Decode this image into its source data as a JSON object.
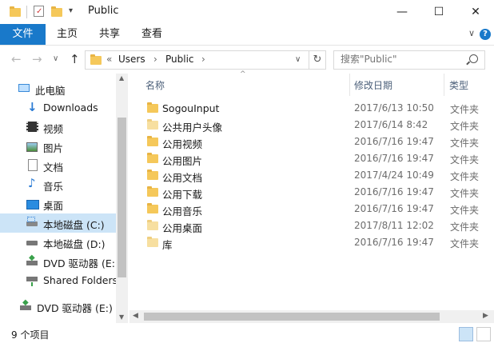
{
  "window": {
    "title": "Public",
    "minimize": "—",
    "maximize": "☐",
    "close": "✕"
  },
  "ribbon": {
    "file_tab": "文件",
    "tabs": [
      "主页",
      "共享",
      "查看"
    ],
    "help": "?",
    "collapse": "∨"
  },
  "nav": {
    "back": "←",
    "forward": "→",
    "recent": "∨",
    "up": "↑",
    "breadcrumb_overflow": "«",
    "crumbs": [
      "Users",
      "Public"
    ],
    "sep": "›",
    "dropdown": "∨",
    "refresh": "↻",
    "search_placeholder": "搜索\"Public\""
  },
  "sidebar": {
    "items": [
      {
        "label": "此电脑",
        "icon": "computer-icon"
      },
      {
        "label": "Downloads",
        "icon": "download-icon"
      },
      {
        "label": "视频",
        "icon": "video-icon"
      },
      {
        "label": "图片",
        "icon": "picture-icon"
      },
      {
        "label": "文档",
        "icon": "document-icon"
      },
      {
        "label": "音乐",
        "icon": "music-icon"
      },
      {
        "label": "桌面",
        "icon": "desktop-icon"
      },
      {
        "label": "本地磁盘 (C:)",
        "icon": "drive-icon",
        "selected": true
      },
      {
        "label": "本地磁盘 (D:)",
        "icon": "drive-icon"
      },
      {
        "label": "DVD 驱动器 (E:)",
        "icon": "dvd-icon"
      },
      {
        "label": "Shared Folders",
        "icon": "network-drive-icon"
      },
      {
        "label": "DVD 驱动器 (E:) C",
        "icon": "dvd-icon"
      }
    ]
  },
  "columns": {
    "name": "名称",
    "date": "修改日期",
    "type": "类型"
  },
  "files": [
    {
      "name": "SogouInput",
      "date": "2017/6/13 10:50",
      "type": "文件夹",
      "pale": false
    },
    {
      "name": "公共用户头像",
      "date": "2017/6/14 8:42",
      "type": "文件夹",
      "pale": true
    },
    {
      "name": "公用视频",
      "date": "2016/7/16 19:47",
      "type": "文件夹",
      "pale": false
    },
    {
      "name": "公用图片",
      "date": "2016/7/16 19:47",
      "type": "文件夹",
      "pale": false
    },
    {
      "name": "公用文档",
      "date": "2017/4/24 10:49",
      "type": "文件夹",
      "pale": false
    },
    {
      "name": "公用下载",
      "date": "2016/7/16 19:47",
      "type": "文件夹",
      "pale": false
    },
    {
      "name": "公用音乐",
      "date": "2016/7/16 19:47",
      "type": "文件夹",
      "pale": false
    },
    {
      "name": "公用桌面",
      "date": "2017/8/11 12:02",
      "type": "文件夹",
      "pale": true
    },
    {
      "name": "库",
      "date": "2016/7/16 19:47",
      "type": "文件夹",
      "pale": true
    }
  ],
  "status": {
    "count": "9 个项目"
  },
  "colors": {
    "accent": "#1979ca",
    "selection": "#cce4f7",
    "folder": "#f5c85a"
  }
}
